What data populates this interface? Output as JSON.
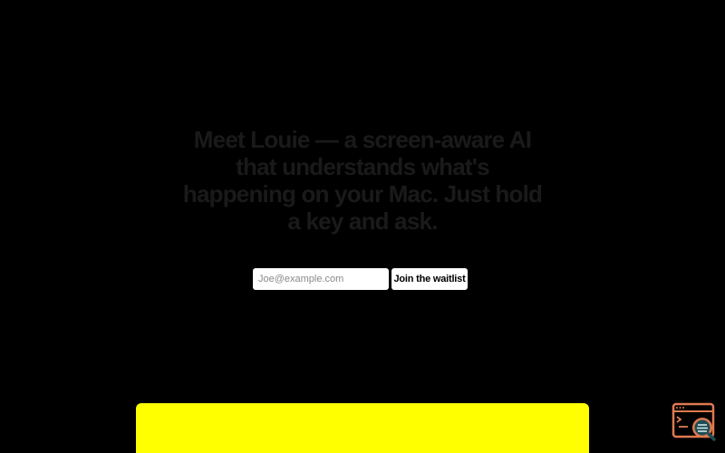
{
  "hero": {
    "heading": "Meet Louie — a screen-aware AI that understands what's happening on your Mac. Just hold a key and ask."
  },
  "signup": {
    "email_placeholder": "Joe@example.com",
    "button_label": "Join the waitlist"
  },
  "colors": {
    "background": "#000000",
    "heading_text": "#1a1a1a",
    "panel_accent": "#ffff00",
    "widget_orange": "#e07a4f",
    "widget_teal": "#1f4d55"
  },
  "widget": {
    "icon": "browser-search-icon"
  }
}
